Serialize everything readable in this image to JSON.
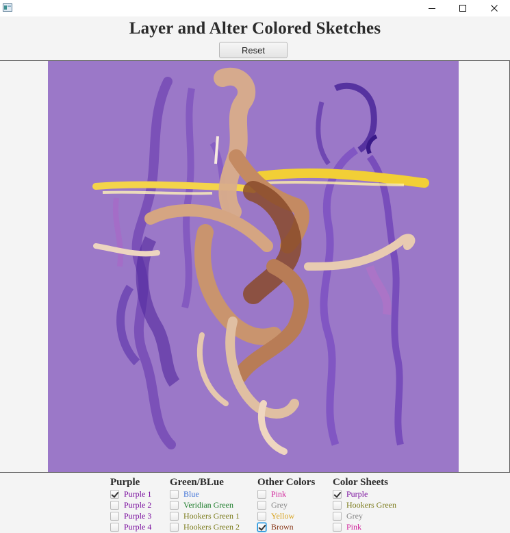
{
  "window": {
    "title": "Layer and Alter Colored Sketches",
    "controls": {
      "minimize": "minimize-icon",
      "maximize": "maximize-icon",
      "close": "close-icon"
    }
  },
  "toolbar": {
    "reset_label": "Reset"
  },
  "canvas": {
    "background": "#9b78c8"
  },
  "groups": [
    {
      "title": "Purple",
      "items": [
        {
          "label": "Purple 1",
          "checked": true,
          "color": "#7a0e9e"
        },
        {
          "label": "Purple 2",
          "checked": false,
          "color": "#7a0e9e"
        },
        {
          "label": "Purple 3",
          "checked": false,
          "color": "#7a0e9e"
        },
        {
          "label": "Purple 4",
          "checked": false,
          "color": "#7a0e9e"
        }
      ]
    },
    {
      "title": "Green/BLue",
      "items": [
        {
          "label": "Blue",
          "checked": false,
          "color": "#3b6fd6"
        },
        {
          "label": "Veridian Green",
          "checked": false,
          "color": "#1c7c2a"
        },
        {
          "label": "Hookers Green 1",
          "checked": false,
          "color": "#7a7a1a"
        },
        {
          "label": "Hookers Green 2",
          "checked": false,
          "color": "#7a7a1a"
        }
      ]
    },
    {
      "title": "Other Colors",
      "items": [
        {
          "label": "Pink",
          "checked": false,
          "color": "#d0219a"
        },
        {
          "label": "Grey",
          "checked": false,
          "color": "#858585"
        },
        {
          "label": "Yellow",
          "checked": false,
          "color": "#d7a21e"
        },
        {
          "label": "Brown",
          "checked": true,
          "color": "#8a3a1c"
        }
      ]
    },
    {
      "title": "Color Sheets",
      "items": [
        {
          "label": "Purple",
          "checked": true,
          "color": "#7a0e9e"
        },
        {
          "label": "Hookers Green",
          "checked": false,
          "color": "#7a7a1a"
        },
        {
          "label": "Grey",
          "checked": false,
          "color": "#858585"
        },
        {
          "label": "Pink",
          "checked": false,
          "color": "#d0219a"
        }
      ]
    }
  ]
}
